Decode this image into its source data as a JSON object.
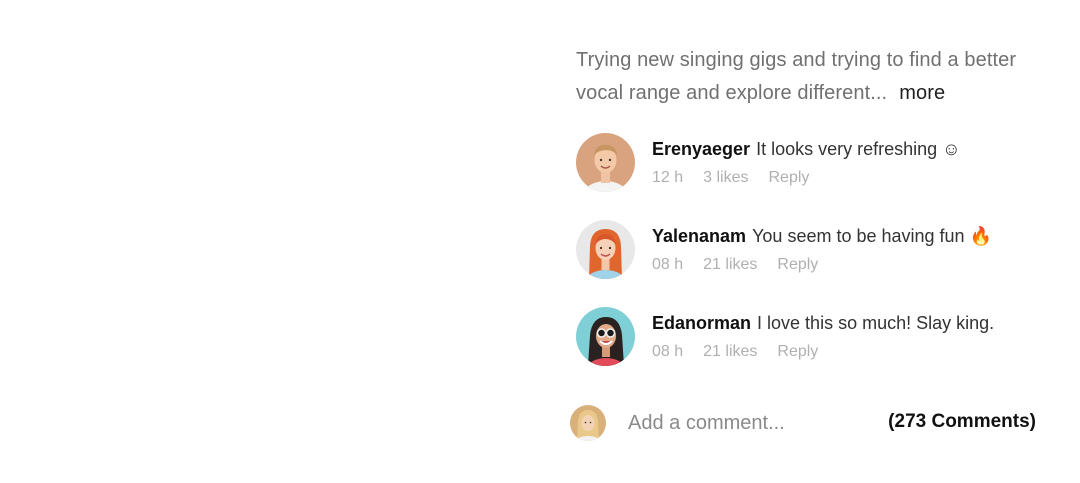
{
  "post": {
    "caption_text": "Trying new singing gigs and trying to find a better vocal range and explore different...",
    "more_label": "more"
  },
  "comments": [
    {
      "username": "Erenyaeger",
      "text": "It looks very refreshing ☺",
      "time": "12 h",
      "likes": "3 likes",
      "reply_label": "Reply",
      "avatar_bg": "#d9a37f"
    },
    {
      "username": "Yalenanam",
      "text": "You seem to be having fun 🔥",
      "time": "08 h",
      "likes": "21 likes",
      "reply_label": "Reply",
      "avatar_bg": "#e8e8e8"
    },
    {
      "username": "Edanorman",
      "text": "I love this so much! Slay king.",
      "time": "08 h",
      "likes": "21 likes",
      "reply_label": "Reply",
      "avatar_bg": "#7fd0d6"
    }
  ],
  "composer": {
    "placeholder": "Add a comment...",
    "comments_count": "(273 Comments)"
  },
  "colors": {
    "caption_text": "#707070",
    "meta_text": "#b0b0b0",
    "username": "#111111"
  }
}
